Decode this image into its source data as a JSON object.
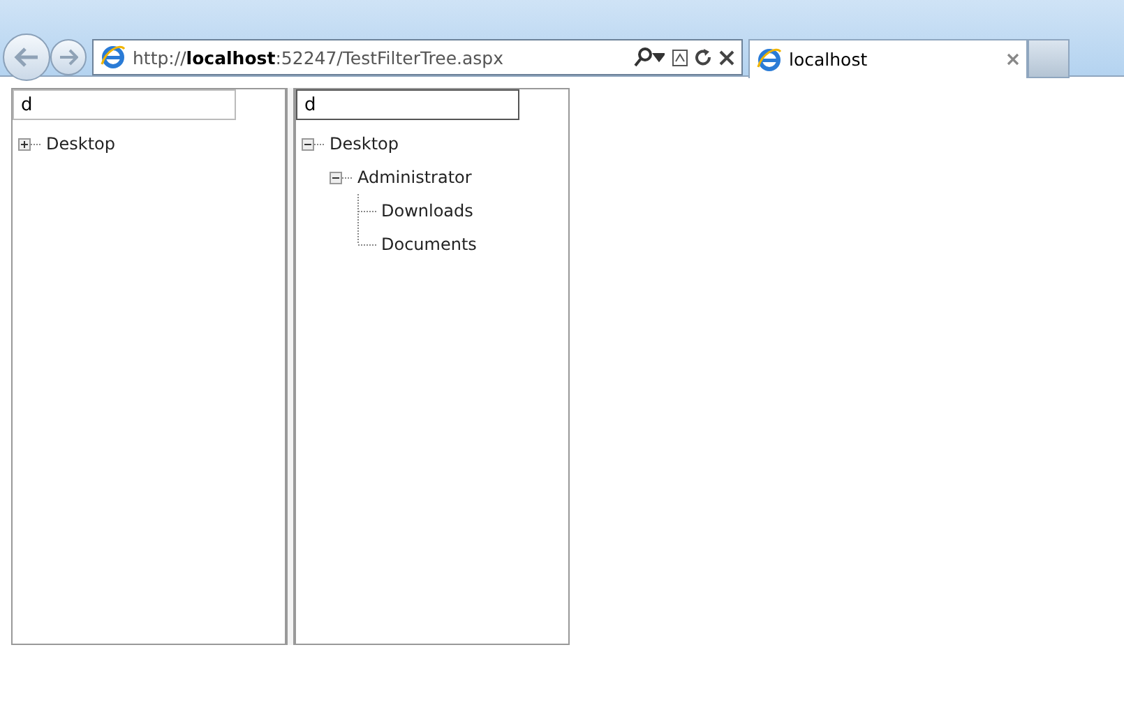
{
  "browser": {
    "url": "http://**localhost**:52247/TestFilterTree.aspx",
    "tab_title": "localhost"
  },
  "panes": [
    {
      "filter": {
        "value": "d",
        "focused": false
      },
      "tree": [
        {
          "label": "Desktop",
          "expanded": false
        }
      ]
    },
    {
      "filter": {
        "value": "d",
        "focused": true
      },
      "tree": [
        {
          "label": "Desktop",
          "expanded": true,
          "children": [
            {
              "label": "Administrator",
              "expanded": true,
              "children": [
                {
                  "label": "Downloads"
                },
                {
                  "label": "Documents"
                }
              ]
            }
          ]
        }
      ]
    }
  ]
}
